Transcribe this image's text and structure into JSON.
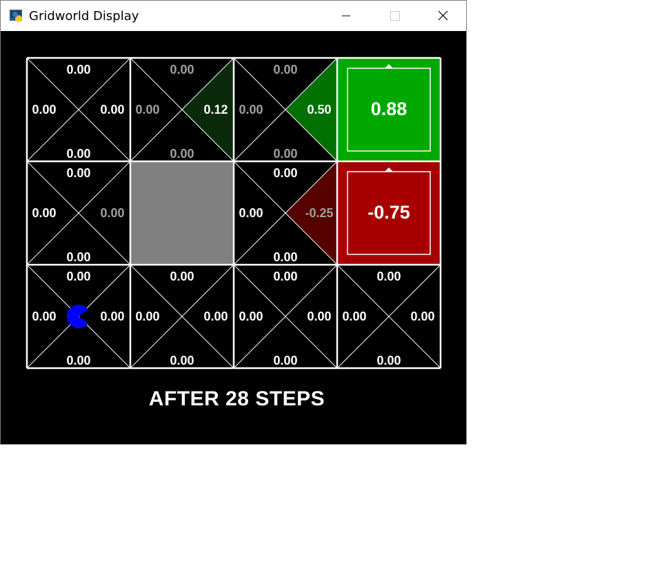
{
  "window": {
    "title": "Gridworld Display",
    "controls": [
      "minimize",
      "maximize",
      "close"
    ]
  },
  "grid": {
    "rows": 3,
    "cols": 4,
    "status_text": "AFTER 28 STEPS",
    "agent_cell": [
      2,
      0
    ],
    "cells": [
      [
        {
          "type": "q",
          "north": "0.00",
          "east": "0.00",
          "south": "0.00",
          "west": "0.00",
          "fills": {}
        },
        {
          "type": "q",
          "north": "0.00",
          "east": "0.12",
          "south": "0.00",
          "west": "0.00",
          "fills": {
            "east": "#0b2a0b"
          }
        },
        {
          "type": "q",
          "north": "0.00",
          "east": "0.50",
          "south": "0.00",
          "west": "0.00",
          "fills": {
            "east": "#007000"
          }
        },
        {
          "type": "terminal",
          "value": "0.88",
          "color": "#00a800"
        }
      ],
      [
        {
          "type": "q",
          "north": "0.00",
          "east": "0.00",
          "south": "0.00",
          "west": "0.00",
          "fills": {}
        },
        {
          "type": "wall",
          "color": "#808080"
        },
        {
          "type": "q",
          "north": "0.00",
          "east": "-0.25",
          "south": "0.00",
          "west": "0.00",
          "fills": {
            "east": "#560000"
          }
        },
        {
          "type": "terminal",
          "value": "-0.75",
          "color": "#a80000"
        }
      ],
      [
        {
          "type": "q",
          "north": "0.00",
          "east": "0.00",
          "south": "0.00",
          "west": "0.00",
          "fills": {}
        },
        {
          "type": "q",
          "north": "0.00",
          "east": "0.00",
          "south": "0.00",
          "west": "0.00",
          "fills": {}
        },
        {
          "type": "q",
          "north": "0.00",
          "east": "0.00",
          "south": "0.00",
          "west": "0.00",
          "fills": {}
        },
        {
          "type": "q",
          "north": "0.00",
          "east": "0.00",
          "south": "0.00",
          "west": "0.00",
          "fills": {}
        }
      ]
    ]
  },
  "colors": {
    "background": "#000000",
    "grid_line": "#ffffff",
    "text_bright": "#ffffff",
    "text_dim": "#a0a0a0",
    "agent": "#0000ff"
  }
}
